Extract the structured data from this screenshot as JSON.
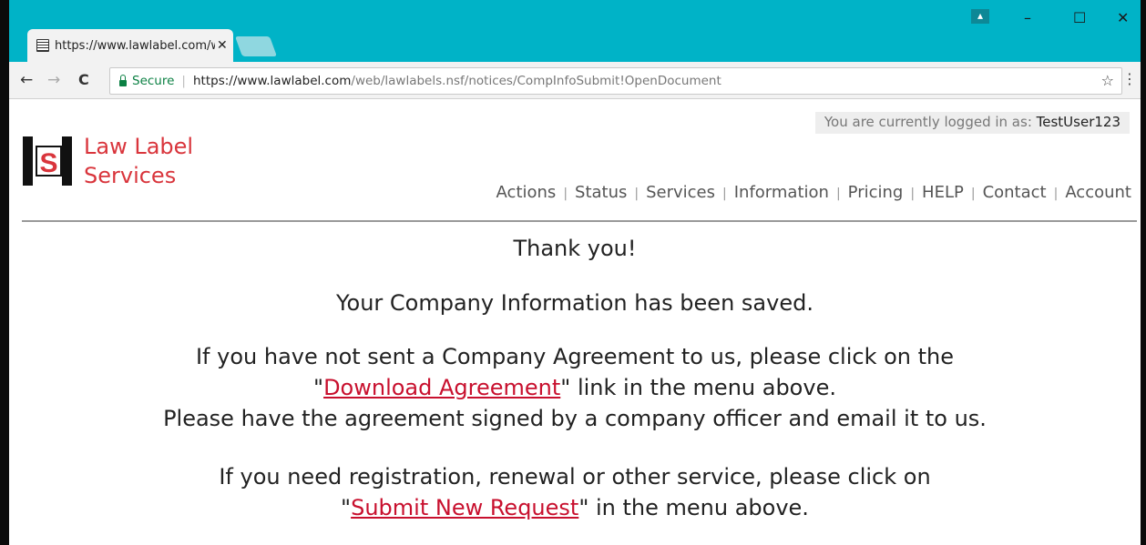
{
  "browser": {
    "tab_title": "https://www.lawlabel.com/web/lawlabels.nsf/notices/CompInfoSubmit!OpenDocument",
    "tab_close": "✕",
    "profile_icon": "person-icon",
    "minimize": "–",
    "maximize": "☐",
    "close": "✕",
    "secure_label": "Secure",
    "url_host": "https://www.lawlabel.com",
    "url_path": "/web/lawlabels.nsf/notices/CompInfoSubmit!OpenDocument",
    "back": "←",
    "forward": "→",
    "reload": "C",
    "star": "☆",
    "menu": "⋮"
  },
  "header": {
    "login_prefix": "You are currently logged in as: ",
    "login_user": "TestUser123",
    "brand_line1": "Law Label",
    "brand_line2": "Services",
    "logo_letter": "S"
  },
  "nav": {
    "items": [
      "Actions",
      "Status",
      "Services",
      "Information",
      "Pricing",
      "HELP",
      "Contact",
      "Account"
    ],
    "separator": "|"
  },
  "message": {
    "thanks": "Thank you!",
    "saved": "Your Company Information has been saved.",
    "agreement_line1": "If you have not sent a Company Agreement to us, please click on the",
    "quote_open": "\"",
    "agreement_link": "Download Agreement",
    "agreement_line2_suffix": "\" link in the menu above.",
    "agreement_line3": "Please have the agreement signed by a company officer and email it to us.",
    "request_line1": "If you need registration, renewal or other service, please click on",
    "request_link": "Submit New Request",
    "request_line2_suffix": "\" in the menu above."
  },
  "colors": {
    "titlebar": "#00b3c7",
    "brand_red": "#d9353c",
    "link_red": "#c8102e",
    "secure_green": "#0b8043"
  }
}
